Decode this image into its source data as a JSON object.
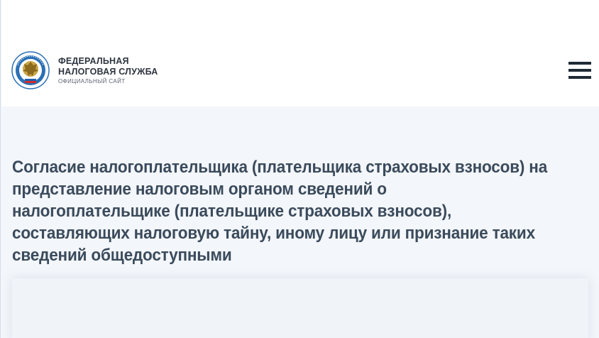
{
  "header": {
    "logo_line1": "ФЕДЕРАЛЬНАЯ",
    "logo_line2": "НАЛОГОВАЯ СЛУЖБА",
    "logo_sub": "ОФИЦИАЛЬНЫЙ САЙТ",
    "menu_icon": "hamburger-menu-icon",
    "emblem_icon": "fns-emblem-icon"
  },
  "main": {
    "title": "Согласие налогоплательщика (плательщика страховых взносов) на представление налоговым органом сведений о налогоплательщике (плательщике страховых взносов), составляющих налоговую тайну, иному лицу или признание таких сведений общедоступными"
  },
  "colors": {
    "header_bg": "#ffffff",
    "page_bg": "#f3f6fa",
    "title_color": "#3b4b5c",
    "emblem_blue": "#2a6fb5",
    "emblem_gold": "#c9a646"
  }
}
